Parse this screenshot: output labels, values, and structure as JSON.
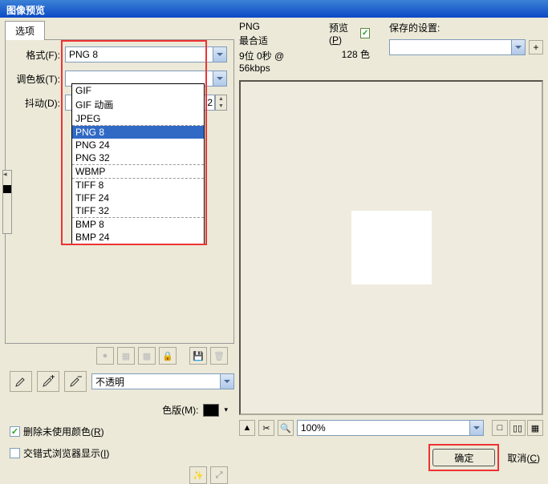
{
  "title": "图像预览",
  "tab": "选项",
  "labels": {
    "format": "格式(F):",
    "palette": "调色板(T):",
    "dither": "抖动(D):",
    "transparent": "不透明",
    "matte": "色版(M):",
    "deleteUnused": "删除未使用颜色(R)",
    "interlace": "交错式浏览器显示(I)"
  },
  "format_value": "PNG 8",
  "format_options": [
    "GIF",
    "GIF 动画",
    "JPEG",
    "PNG 8",
    "PNG 24",
    "PNG 32",
    "WBMP",
    "TIFF 8",
    "TIFF 24",
    "TIFF 32",
    "BMP 8",
    "BMP 24"
  ],
  "info": {
    "format": "PNG",
    "fit": "最合适",
    "size": "9位  0秒 @ 56kbps",
    "previewLabel": "预览(P)",
    "colors": "128 色",
    "savedLabel": "保存的设置:"
  },
  "zoom": "100%",
  "buttons": {
    "ok": "确定",
    "cancel": "取消(C)"
  }
}
